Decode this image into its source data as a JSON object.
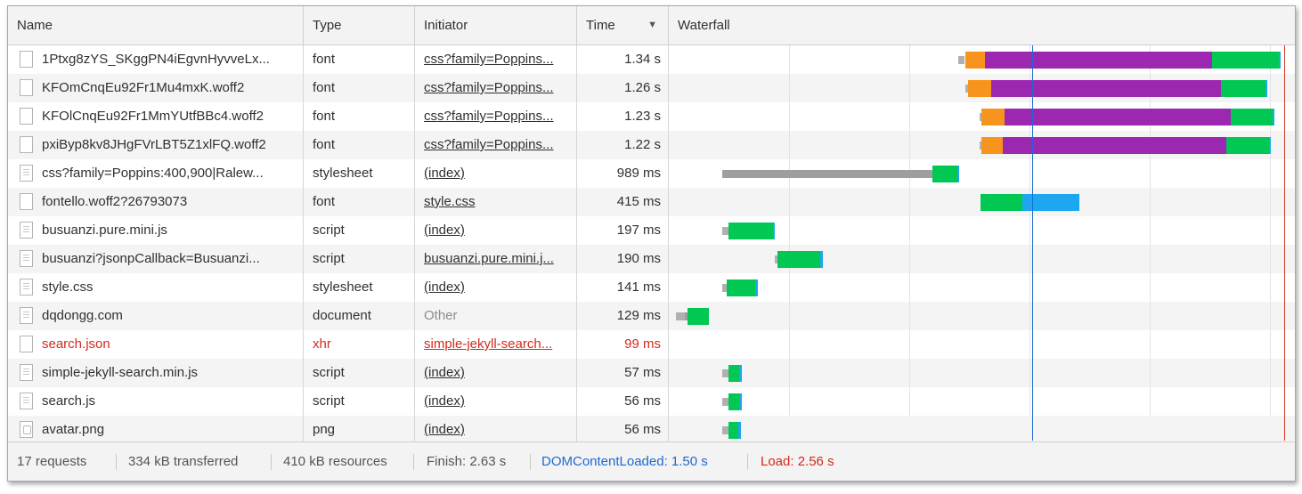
{
  "columns": {
    "name": "Name",
    "type": "Type",
    "initiator": "Initiator",
    "time": "Time",
    "sort_icon": "sort-descending-icon",
    "waterfall": "Waterfall"
  },
  "rows": [
    {
      "name": "1Ptxg8zYS_SKggPN4iEgvnHyvveLx...",
      "type": "font",
      "initiator": "css?family=Poppins...",
      "time": "1.34 s",
      "icon": "file-icon"
    },
    {
      "name": "KFOmCnqEu92Fr1Mu4mxK.woff2",
      "type": "font",
      "initiator": "css?family=Poppins...",
      "time": "1.26 s",
      "icon": "file-icon"
    },
    {
      "name": "KFOlCnqEu92Fr1MmYUtfBBc4.woff2",
      "type": "font",
      "initiator": "css?family=Poppins...",
      "time": "1.23 s",
      "icon": "file-icon"
    },
    {
      "name": "pxiByp8kv8JHgFVrLBT5Z1xlFQ.woff2",
      "type": "font",
      "initiator": "css?family=Poppins...",
      "time": "1.22 s",
      "icon": "file-icon"
    },
    {
      "name": "css?family=Poppins:400,900|Ralew...",
      "type": "stylesheet",
      "initiator": "(index)",
      "time": "989 ms",
      "icon": "document-icon"
    },
    {
      "name": "fontello.woff2?26793073",
      "type": "font",
      "initiator": "style.css",
      "time": "415 ms",
      "icon": "file-icon"
    },
    {
      "name": "busuanzi.pure.mini.js",
      "type": "script",
      "initiator": "(index)",
      "time": "197 ms",
      "icon": "document-icon"
    },
    {
      "name": "busuanzi?jsonpCallback=Busuanzi...",
      "type": "script",
      "initiator": "busuanzi.pure.mini.j...",
      "time": "190 ms",
      "icon": "document-icon"
    },
    {
      "name": "style.css",
      "type": "stylesheet",
      "initiator": "(index)",
      "time": "141 ms",
      "icon": "document-icon"
    },
    {
      "name": "dqdongg.com",
      "type": "document",
      "initiator": "Other",
      "time": "129 ms",
      "icon": "document-icon"
    },
    {
      "name": "search.json",
      "type": "xhr",
      "initiator": "simple-jekyll-search...",
      "time": "99 ms",
      "icon": "file-icon",
      "error": true
    },
    {
      "name": "simple-jekyll-search.min.js",
      "type": "script",
      "initiator": "(index)",
      "time": "57 ms",
      "icon": "document-icon"
    },
    {
      "name": "search.js",
      "type": "script",
      "initiator": "(index)",
      "time": "56 ms",
      "icon": "document-icon"
    },
    {
      "name": "avatar.png",
      "type": "png",
      "initiator": "(index)",
      "time": "56 ms",
      "icon": "image-icon"
    }
  ],
  "footer": {
    "requests": "17 requests",
    "transferred": "334 kB transferred",
    "resources": "410 kB resources",
    "finish": "Finish: 2.63 s",
    "dom_content_loaded": "DOMContentLoaded: 1.50 s",
    "load": "Load: 2.56 s"
  },
  "colors": {
    "queueing": "#b0b0b0",
    "stalled": "#9e9e9e",
    "ssl": "#f7941d",
    "connect": "#9c27b0",
    "waiting": "#00c853",
    "download": "#1ea7f0",
    "dom_line": "#1e69d2",
    "load_line": "#d53a2a"
  }
}
